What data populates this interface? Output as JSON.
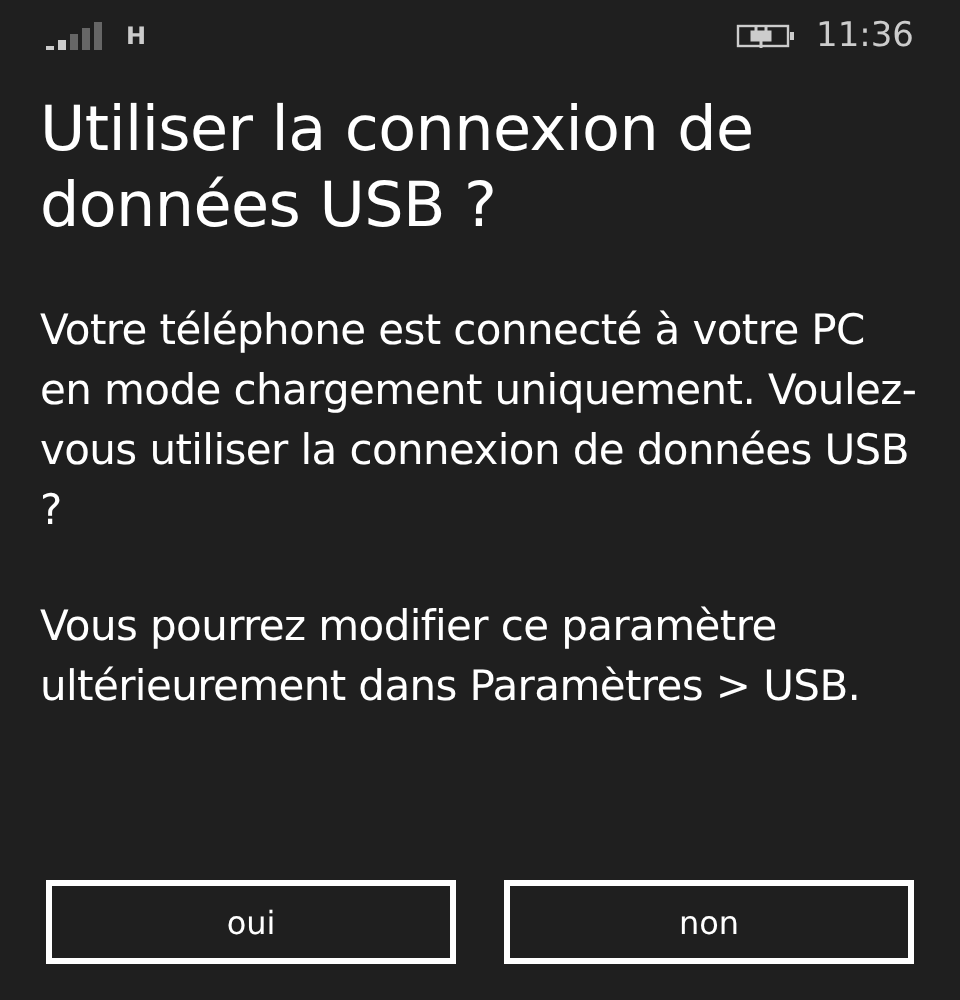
{
  "status_bar": {
    "network": "H",
    "time": "11:36"
  },
  "title": "Utiliser la connexion de données USB ?",
  "paragraphs": [
    "Votre téléphone est connecté à votre PC en mode chargement uniquement. Voulez-vous utiliser la connexion de données USB ?",
    "Vous pourrez modifier ce paramètre ultérieurement dans Paramètres > USB."
  ],
  "buttons": [
    "oui",
    "non"
  ]
}
